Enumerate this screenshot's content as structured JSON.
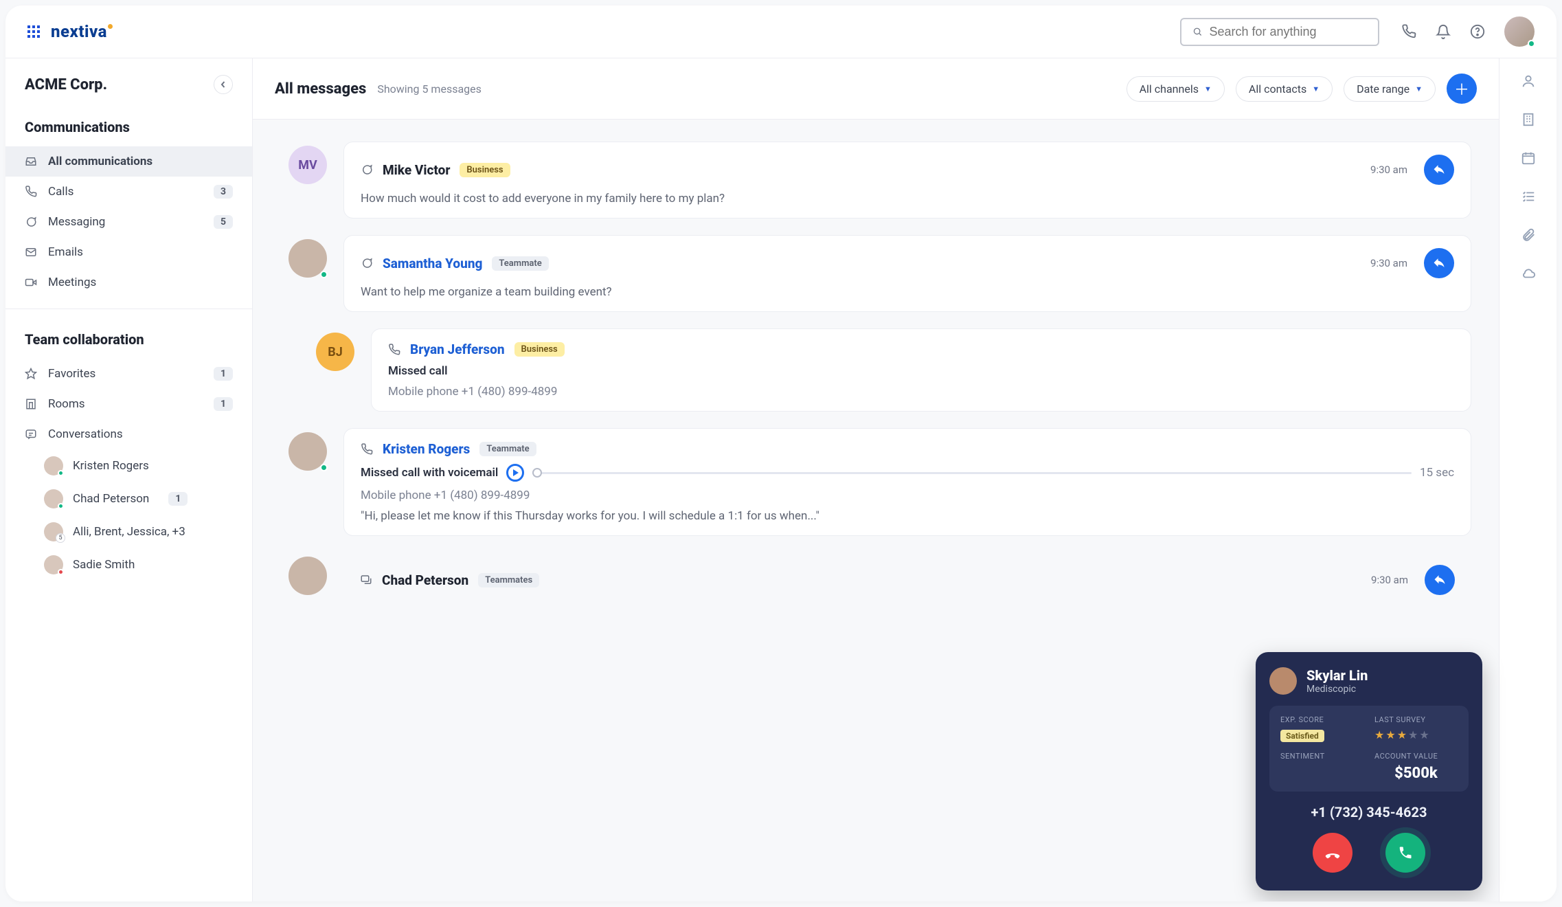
{
  "brand": "nextiva",
  "search": {
    "placeholder": "Search for anything"
  },
  "workspace": {
    "name": "ACME Corp."
  },
  "sidebar": {
    "section1_title": "Communications",
    "items": [
      {
        "label": "All communications"
      },
      {
        "label": "Calls",
        "badge": "3"
      },
      {
        "label": "Messaging",
        "badge": "5"
      },
      {
        "label": "Emails"
      },
      {
        "label": "Meetings"
      }
    ],
    "section2_title": "Team collaboration",
    "team_items": [
      {
        "label": "Favorites",
        "badge": "1"
      },
      {
        "label": "Rooms",
        "badge": "1"
      },
      {
        "label": "Conversations"
      }
    ],
    "conversations": [
      {
        "label": "Kristen Rogers"
      },
      {
        "label": "Chad Peterson",
        "badge": "1"
      },
      {
        "label": "Alli, Brent, Jessica, +3"
      },
      {
        "label": "Sadie Smith"
      }
    ]
  },
  "main": {
    "title": "All messages",
    "subtitle": "Showing 5 messages",
    "filters": {
      "channels": "All channels",
      "contacts": "All contacts",
      "date": "Date range"
    }
  },
  "messages": [
    {
      "avatar": "MV",
      "avatar_type": "initials",
      "kind": "chat",
      "name": "Mike Victor",
      "name_link": false,
      "tag": "Business",
      "tag_type": "biz",
      "time": "9:30 am",
      "preview": "How much would it cost to add everyone in my family here to my plan?",
      "has_reply": true
    },
    {
      "avatar_type": "photo",
      "kind": "chat",
      "name": "Samantha Young",
      "name_link": true,
      "tag": "Teammate",
      "tag_type": "team",
      "time": "9:30 am",
      "preview": "Want to help me organize a team building event?",
      "has_reply": true
    },
    {
      "avatar": "BJ",
      "avatar_type": "initials",
      "avatar_color": "orange",
      "kind": "call",
      "name": "Bryan Jefferson",
      "name_link": true,
      "tag": "Business",
      "tag_type": "biz",
      "line1": "Missed call",
      "line2": "Mobile phone +1 (480) 899-4899",
      "nested": true
    },
    {
      "avatar_type": "photo",
      "kind": "call",
      "name": "Kristen Rogers",
      "name_link": true,
      "tag": "Teammate",
      "tag_type": "team",
      "voicemail_label": "Missed call with voicemail",
      "duration": "15 sec",
      "line2": "Mobile phone +1 (480) 899-4899",
      "transcript": "\"Hi, please let me know if this Thursday works for you. I will schedule a 1:1 for us when...\""
    },
    {
      "avatar_type": "photo",
      "kind": "thread",
      "name": "Chad Peterson",
      "name_link": false,
      "tag": "Teammates",
      "tag_type": "team",
      "time": "9:30 am",
      "has_reply": true
    }
  ],
  "call": {
    "name": "Skylar Lin",
    "company": "Mediscopic",
    "exp_score_label": "EXP. SCORE",
    "exp_score_value": "Satisfied",
    "last_survey_label": "LAST SURVEY",
    "stars_filled": 3,
    "sentiment_label": "SENTIMENT",
    "account_value_label": "ACCOUNT VALUE",
    "account_value": "$500k",
    "phone": "+1 (732) 345-4623"
  }
}
